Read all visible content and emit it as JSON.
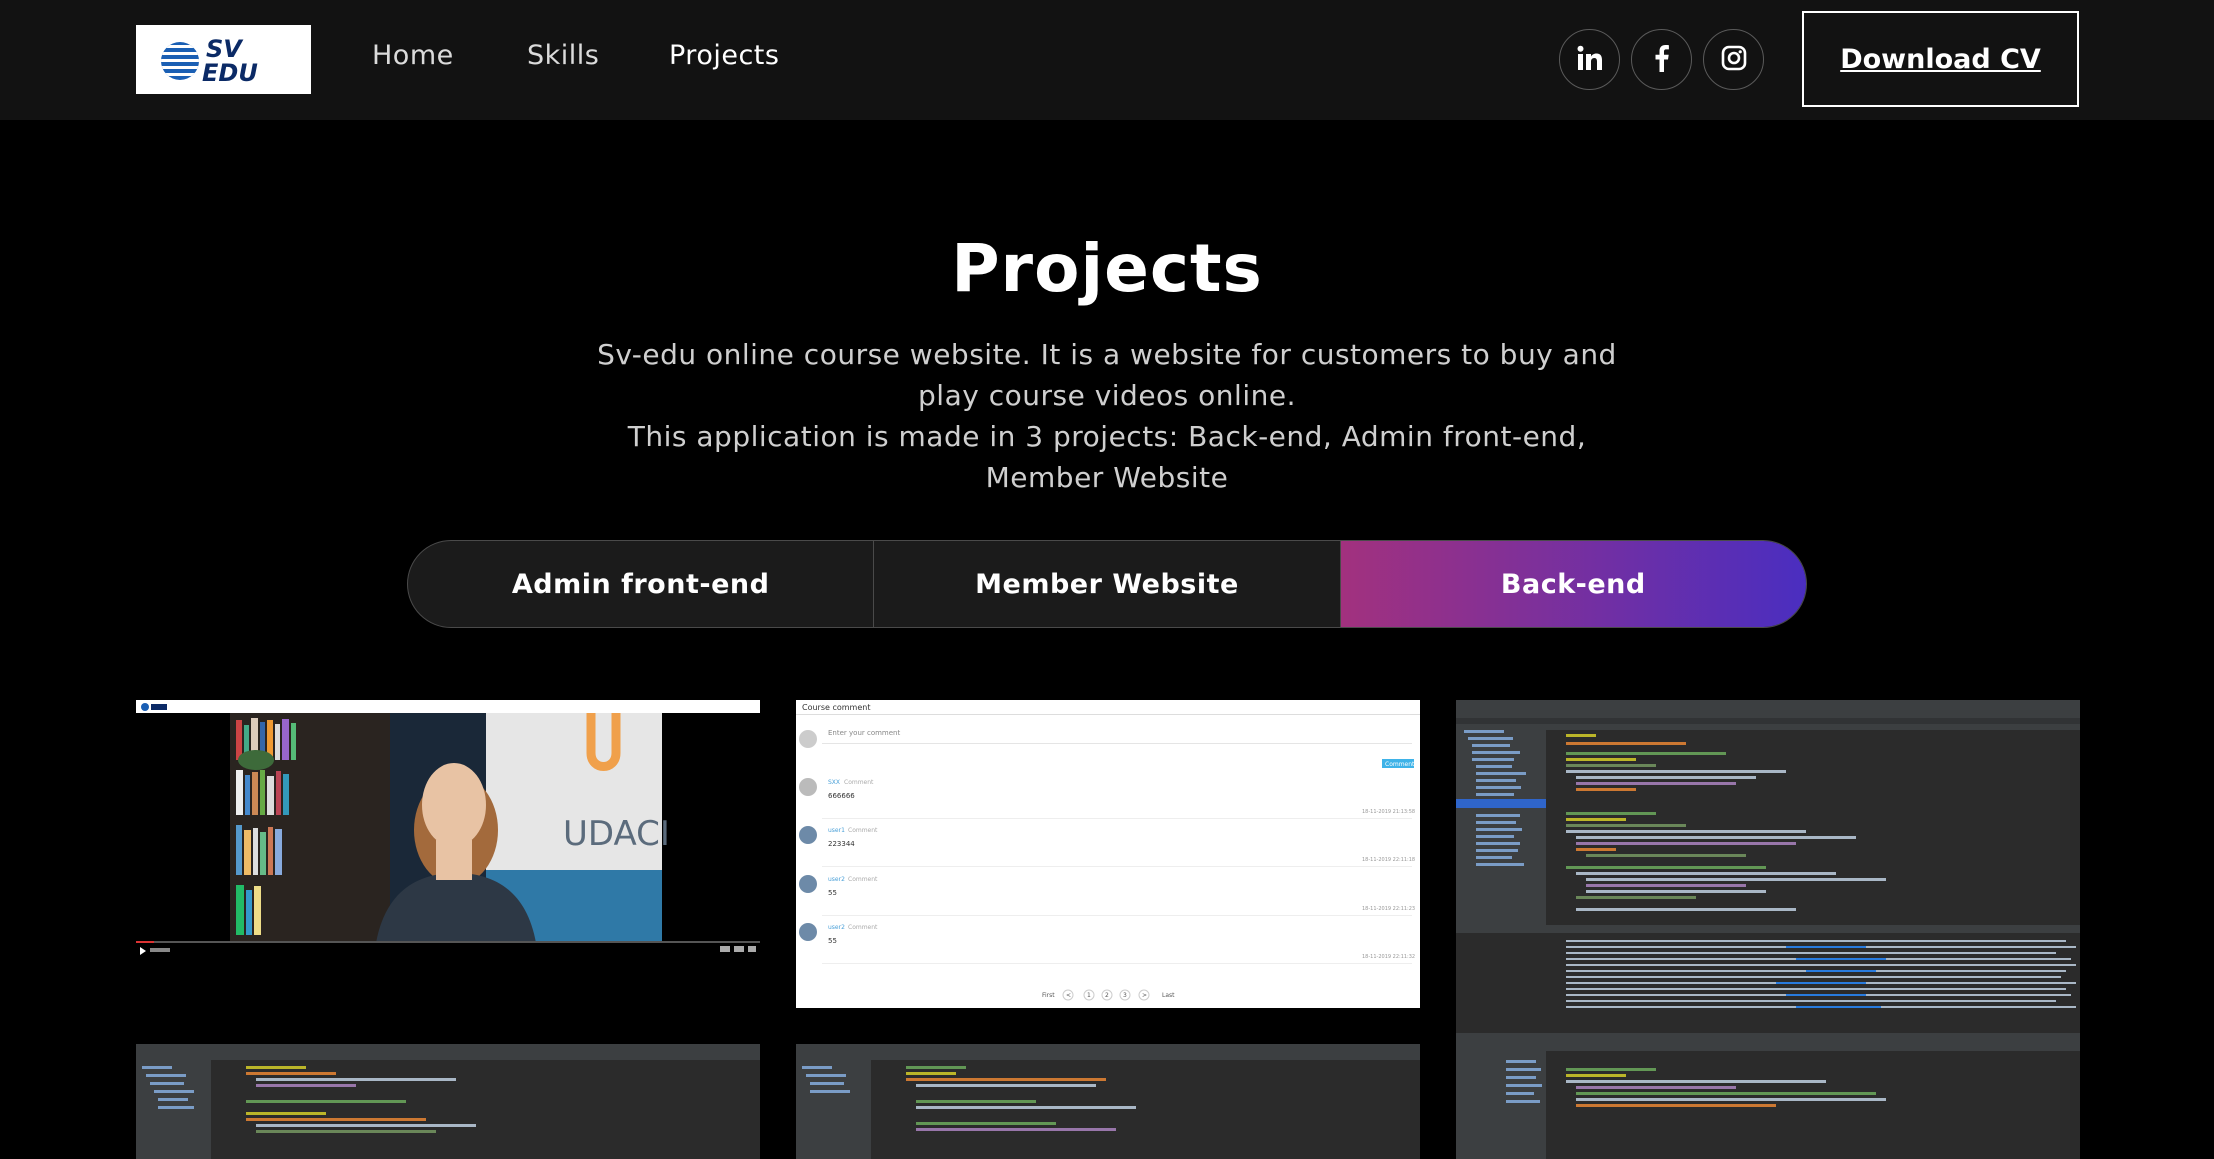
{
  "brand": {
    "logo_text_line1": "SV",
    "logo_text_line2": "EDU"
  },
  "nav": {
    "home": "Home",
    "skills": "Skills",
    "projects": "Projects"
  },
  "social": [
    "linkedin-icon",
    "facebook-icon",
    "instagram-icon"
  ],
  "cv_button": "Download CV",
  "section": {
    "title": "Projects",
    "desc_line1": "Sv-edu online course website. It is a website for customers to buy and play course videos online.",
    "desc_line2": "This application is made in 3 projects: Back-end, Admin front-end, Member Website"
  },
  "tabs": [
    "Admin front-end",
    "Member Website",
    "Back-end"
  ],
  "active_tab": "Back-end",
  "colors": {
    "navbar": "#121212",
    "background": "#000000",
    "tab_gradient_start": "#a2317e",
    "tab_gradient_end": "#4a2ec0"
  },
  "gallery": {
    "video_brand": "UDACI",
    "comment_panel": {
      "header": "Course comment",
      "placeholder": "Enter your comment",
      "submit": "Comment",
      "comments": [
        {
          "user": "SXX",
          "text": "666666",
          "date": "18-11-2019 21:13:58"
        },
        {
          "user": "user1",
          "text": "223344",
          "date": "18-11-2019 22:11:18"
        },
        {
          "user": "user2",
          "text": "55",
          "date": "18-11-2019 22:11:23"
        },
        {
          "user": "user2",
          "text": "55",
          "date": "18-11-2019 22:11:32"
        }
      ],
      "pagination": [
        "First",
        "<",
        "1",
        "2",
        "3",
        ">",
        "Last"
      ]
    }
  }
}
